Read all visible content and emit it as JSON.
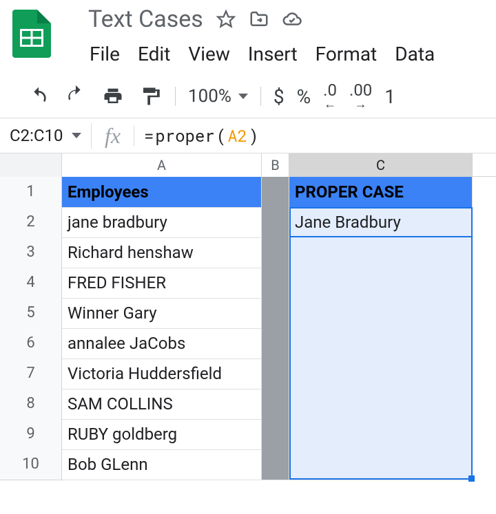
{
  "header": {
    "doc_title": "Text Cases"
  },
  "menu": {
    "items": [
      "File",
      "Edit",
      "View",
      "Insert",
      "Format",
      "Data"
    ]
  },
  "toolbar": {
    "zoom": "100%",
    "currency": "$",
    "percent": "%",
    "dec_dec": ".0",
    "inc_dec": ".00",
    "trailing": "1"
  },
  "formula_bar": {
    "name_box": "C2:C10",
    "fx_label": "fx",
    "formula_eq": "=",
    "formula_fn": "proper",
    "formula_paren_open": "(",
    "formula_ref": "A2",
    "formula_paren_close": ")"
  },
  "sheet": {
    "columns": [
      "A",
      "B",
      "C"
    ],
    "selected_column": "C",
    "rows": [
      {
        "n": 1,
        "a": "Employees",
        "c": "PROPER CASE",
        "header": true
      },
      {
        "n": 2,
        "a": "jane bradbury",
        "c": "Jane Bradbury"
      },
      {
        "n": 3,
        "a": "Richard henshaw",
        "c": ""
      },
      {
        "n": 4,
        "a": "FRED FISHER",
        "c": ""
      },
      {
        "n": 5,
        "a": "Winner Gary",
        "c": ""
      },
      {
        "n": 6,
        "a": "annalee JaCobs",
        "c": ""
      },
      {
        "n": 7,
        "a": "Victoria Huddersfield",
        "c": ""
      },
      {
        "n": 8,
        "a": "SAM COLLINS",
        "c": ""
      },
      {
        "n": 9,
        "a": "RUBY goldberg",
        "c": ""
      },
      {
        "n": 10,
        "a": "Bob GLenn",
        "c": ""
      }
    ]
  }
}
